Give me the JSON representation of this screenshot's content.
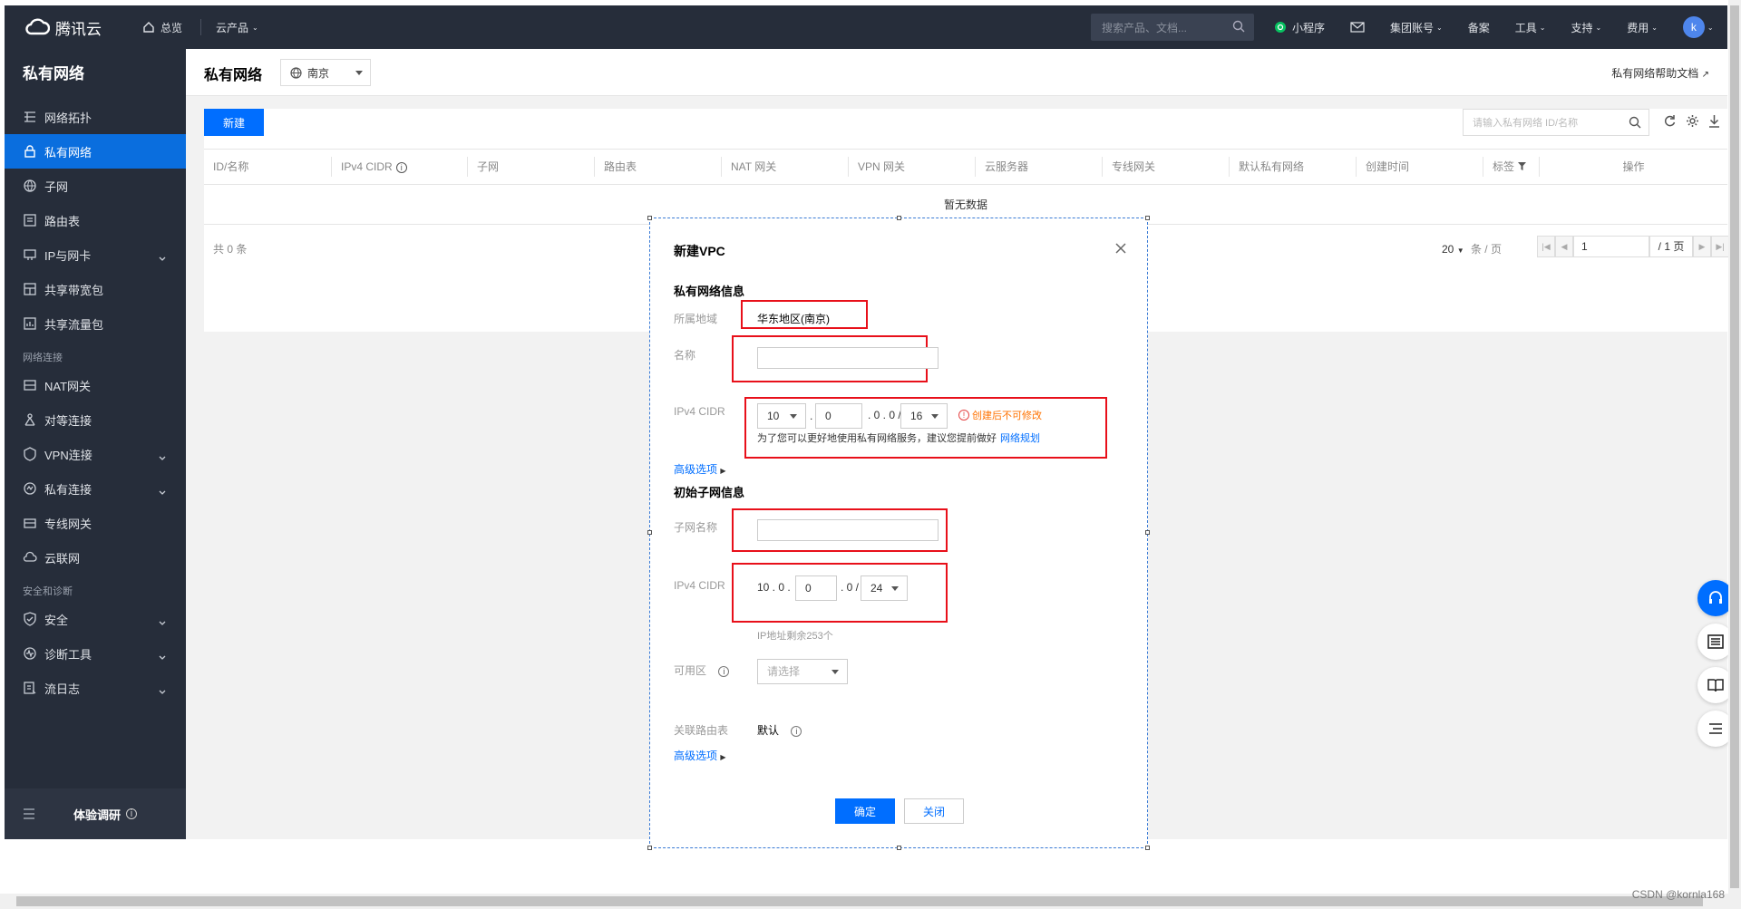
{
  "topbar": {
    "logo_text": "腾讯云",
    "overview": "总览",
    "products": "云产品",
    "search_placeholder": "搜索产品、文档...",
    "mini_program": "小程序",
    "group_account": "集团账号",
    "filing": "备案",
    "tools": "工具",
    "support": "支持",
    "fees": "费用",
    "avatar_letter": "k"
  },
  "sidebar": {
    "title": "私有网络",
    "items": [
      {
        "label": "网络拓扑",
        "icon": "topology-icon"
      },
      {
        "label": "私有网络",
        "icon": "lock-icon",
        "active": true
      },
      {
        "label": "子网",
        "icon": "globe-icon"
      },
      {
        "label": "路由表",
        "icon": "route-table-icon"
      },
      {
        "label": "IP与网卡",
        "icon": "network-card-icon",
        "expand": true
      },
      {
        "label": "共享带宽包",
        "icon": "bandwidth-icon"
      },
      {
        "label": "共享流量包",
        "icon": "traffic-icon"
      }
    ],
    "group_network_connect": "网络连接",
    "connect_items": [
      {
        "label": "NAT网关",
        "icon": "nat-icon"
      },
      {
        "label": "对等连接",
        "icon": "peering-icon"
      },
      {
        "label": "VPN连接",
        "icon": "vpn-icon",
        "expand": true
      },
      {
        "label": "私有连接",
        "icon": "private-link-icon",
        "expand": true
      },
      {
        "label": "专线网关",
        "icon": "dc-gateway-icon"
      },
      {
        "label": "云联网",
        "icon": "ccn-icon"
      }
    ],
    "group_security": "安全和诊断",
    "security_items": [
      {
        "label": "安全",
        "icon": "shield-icon",
        "expand": true
      },
      {
        "label": "诊断工具",
        "icon": "diagnose-icon",
        "expand": true
      },
      {
        "label": "流日志",
        "icon": "flow-log-icon",
        "expand": true
      }
    ],
    "footer_label": "体验调研"
  },
  "page": {
    "title": "私有网络",
    "region": "南京",
    "help_link": "私有网络帮助文档",
    "new_button": "新建",
    "search_placeholder": "请输入私有网络 ID/名称",
    "columns": [
      "ID/名称",
      "IPv4 CIDR",
      "子网",
      "路由表",
      "NAT 网关",
      "VPN 网关",
      "云服务器",
      "专线网关",
      "默认私有网络",
      "创建时间",
      "标签",
      "操作"
    ],
    "no_data": "暂无数据",
    "total": "共 0 条",
    "page_size": "20",
    "page_size_unit": "条 / 页",
    "page_input": "1",
    "page_total": "/ 1 页"
  },
  "modal": {
    "title": "新建VPC",
    "section_vpc": "私有网络信息",
    "region_label": "所属地域",
    "region_value": "华东地区(南京)",
    "name_label": "名称",
    "name_value": "",
    "cidr_label": "IPv4 CIDR",
    "cidr_a": "10",
    "cidr_b": "0",
    "cidr_cd": ". 0 . 0 /",
    "cidr_mask": "16",
    "cidr_warning": "创建后不可修改",
    "cidr_hint": "为了您可以更好地使用私有网络服务，建议您提前做好",
    "cidr_hint_link": "网络规划",
    "advanced": "高级选项",
    "section_subnet": "初始子网信息",
    "subnet_name_label": "子网名称",
    "subnet_name_value": "",
    "subnet_cidr_label": "IPv4 CIDR",
    "subnet_prefix": "10 . 0 .",
    "subnet_c": "0",
    "subnet_d": ". 0 /",
    "subnet_mask": "24",
    "ip_remaining": "IP地址剩余253个",
    "zone_label": "可用区",
    "zone_placeholder": "请选择",
    "route_label": "关联路由表",
    "route_value": "默认",
    "advanced2": "高级选项",
    "ok": "确定",
    "close": "关闭"
  },
  "watermark": "CSDN @kornla168",
  "colors": {
    "accent": "#006eff",
    "nav_bg": "#262d3a",
    "highlight": "#e8101a"
  }
}
